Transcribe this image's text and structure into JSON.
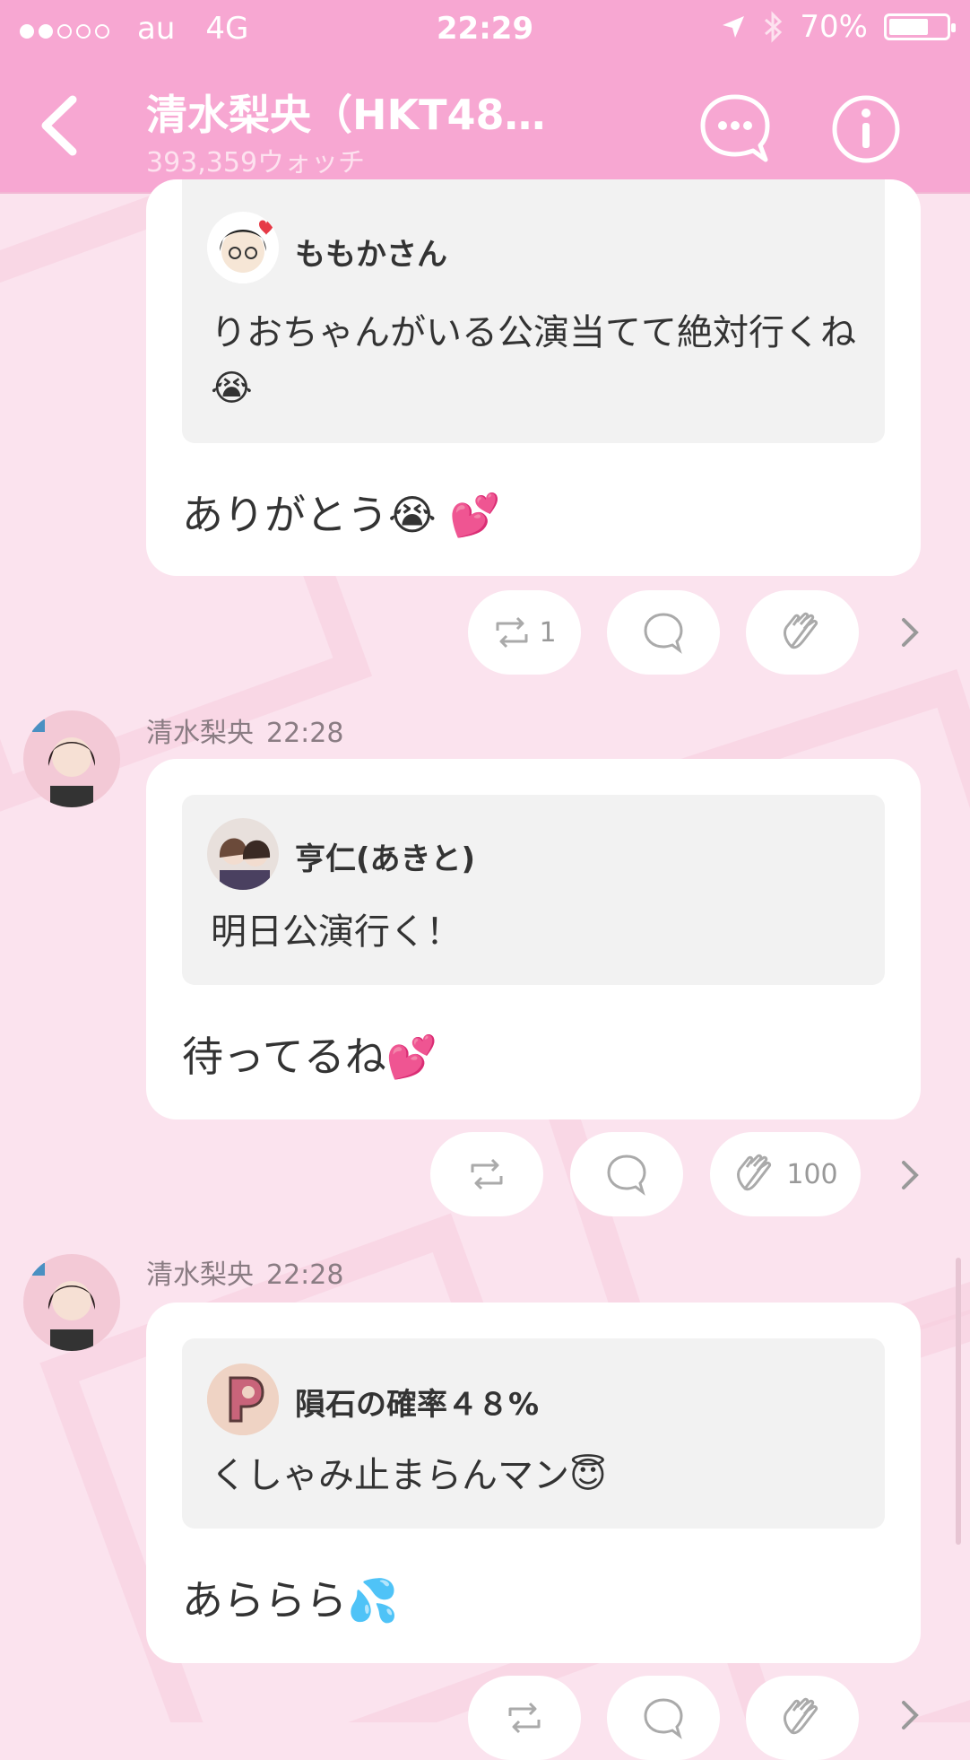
{
  "status_bar": {
    "carrier": "au",
    "network": "4G",
    "time": "22:29",
    "battery": "70%",
    "battery_level": 0.7,
    "signal_dots_on": 2,
    "signal_dots_total": 5
  },
  "header": {
    "title": "清水梨央（HKT48…",
    "subtitle": "393,359ウォッチ"
  },
  "posts": [
    {
      "author": "",
      "time": "",
      "quote": {
        "name": "ももかさん",
        "text": "りおちゃんがいる公演当てて絶対行くね😭"
      },
      "reply": "ありがとう😭 💕",
      "reactions": {
        "repost": "1",
        "comment": "",
        "clap": ""
      }
    },
    {
      "author": "清水梨央",
      "time": "22:28",
      "quote": {
        "name": "亨仁(あきと)",
        "text": "明日公演行く！"
      },
      "reply": "待ってるね💕",
      "reactions": {
        "repost": "",
        "comment": "",
        "clap": "100"
      }
    },
    {
      "author": "清水梨央",
      "time": "22:28",
      "quote": {
        "name": "隕石の確率４８%",
        "text": "くしゃみ止まらんマン😇"
      },
      "reply": "あららら💦",
      "reactions": {
        "repost": "",
        "comment": "",
        "clap": ""
      }
    }
  ],
  "colors": {
    "header": "#f7a7d2",
    "background": "#fbe3ee",
    "card": "#ffffff",
    "quote": "#f2f2f2"
  },
  "icons": [
    "back-icon",
    "chat-bubble-icon",
    "info-icon",
    "repost-icon",
    "comment-icon",
    "clap-icon",
    "chevron-right-icon",
    "location-icon",
    "bluetooth-icon",
    "battery-icon"
  ]
}
